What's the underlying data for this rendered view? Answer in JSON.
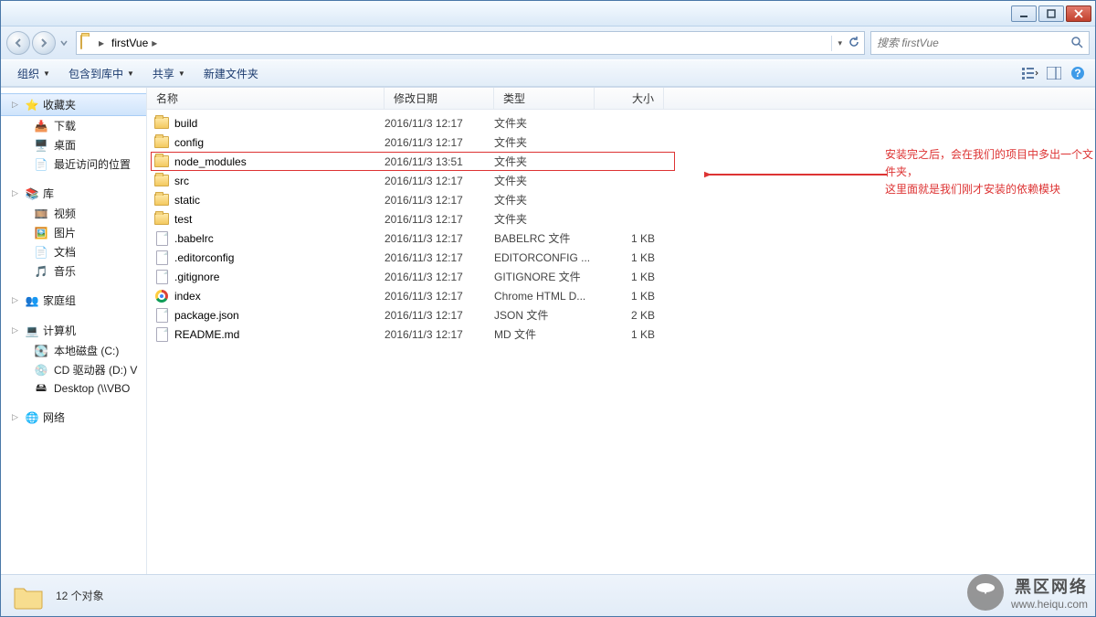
{
  "titlebar": {},
  "address": {
    "folder": "firstVue"
  },
  "search": {
    "placeholder": "搜索 firstVue"
  },
  "toolbar": {
    "organize": "组织",
    "include": "包含到库中",
    "share": "共享",
    "new_folder": "新建文件夹"
  },
  "sidebar": {
    "favorites": {
      "label": "收藏夹",
      "items": [
        {
          "label": "下载",
          "icon": "download-icon"
        },
        {
          "label": "桌面",
          "icon": "desktop-icon"
        },
        {
          "label": "最近访问的位置",
          "icon": "recent-icon"
        }
      ]
    },
    "libraries": {
      "label": "库",
      "items": [
        {
          "label": "视频",
          "icon": "video-icon"
        },
        {
          "label": "图片",
          "icon": "pictures-icon"
        },
        {
          "label": "文档",
          "icon": "documents-icon"
        },
        {
          "label": "音乐",
          "icon": "music-icon"
        }
      ]
    },
    "homegroup": {
      "label": "家庭组"
    },
    "computer": {
      "label": "计算机",
      "items": [
        {
          "label": "本地磁盘 (C:)",
          "icon": "drive-icon"
        },
        {
          "label": "CD 驱动器 (D:) V",
          "icon": "cd-icon"
        },
        {
          "label": "Desktop (\\\\VBO",
          "icon": "netdrive-icon"
        }
      ]
    },
    "network": {
      "label": "网络"
    }
  },
  "columns": {
    "name": "名称",
    "date": "修改日期",
    "type": "类型",
    "size": "大小"
  },
  "files": [
    {
      "name": "build",
      "date": "2016/11/3 12:17",
      "type": "文件夹",
      "size": "",
      "icon": "folder",
      "highlight": false
    },
    {
      "name": "config",
      "date": "2016/11/3 12:17",
      "type": "文件夹",
      "size": "",
      "icon": "folder",
      "highlight": false
    },
    {
      "name": "node_modules",
      "date": "2016/11/3 13:51",
      "type": "文件夹",
      "size": "",
      "icon": "folder",
      "highlight": true
    },
    {
      "name": "src",
      "date": "2016/11/3 12:17",
      "type": "文件夹",
      "size": "",
      "icon": "folder",
      "highlight": false
    },
    {
      "name": "static",
      "date": "2016/11/3 12:17",
      "type": "文件夹",
      "size": "",
      "icon": "folder",
      "highlight": false
    },
    {
      "name": "test",
      "date": "2016/11/3 12:17",
      "type": "文件夹",
      "size": "",
      "icon": "folder",
      "highlight": false
    },
    {
      "name": ".babelrc",
      "date": "2016/11/3 12:17",
      "type": "BABELRC 文件",
      "size": "1 KB",
      "icon": "file",
      "highlight": false
    },
    {
      "name": ".editorconfig",
      "date": "2016/11/3 12:17",
      "type": "EDITORCONFIG ...",
      "size": "1 KB",
      "icon": "file",
      "highlight": false
    },
    {
      "name": ".gitignore",
      "date": "2016/11/3 12:17",
      "type": "GITIGNORE 文件",
      "size": "1 KB",
      "icon": "file",
      "highlight": false
    },
    {
      "name": "index",
      "date": "2016/11/3 12:17",
      "type": "Chrome HTML D...",
      "size": "1 KB",
      "icon": "chrome",
      "highlight": false
    },
    {
      "name": "package.json",
      "date": "2016/11/3 12:17",
      "type": "JSON 文件",
      "size": "2 KB",
      "icon": "file",
      "highlight": false
    },
    {
      "name": "README.md",
      "date": "2016/11/3 12:17",
      "type": "MD 文件",
      "size": "1 KB",
      "icon": "file",
      "highlight": false
    }
  ],
  "annotation": {
    "line1": "安装完之后，会在我们的项目中多出一个文件夹，",
    "line2": "这里面就是我们刚才安装的依赖模块"
  },
  "status": {
    "count_label": "12 个对象"
  },
  "watermark": {
    "cn": "黑区网络",
    "en": "www.heiqu.com"
  }
}
